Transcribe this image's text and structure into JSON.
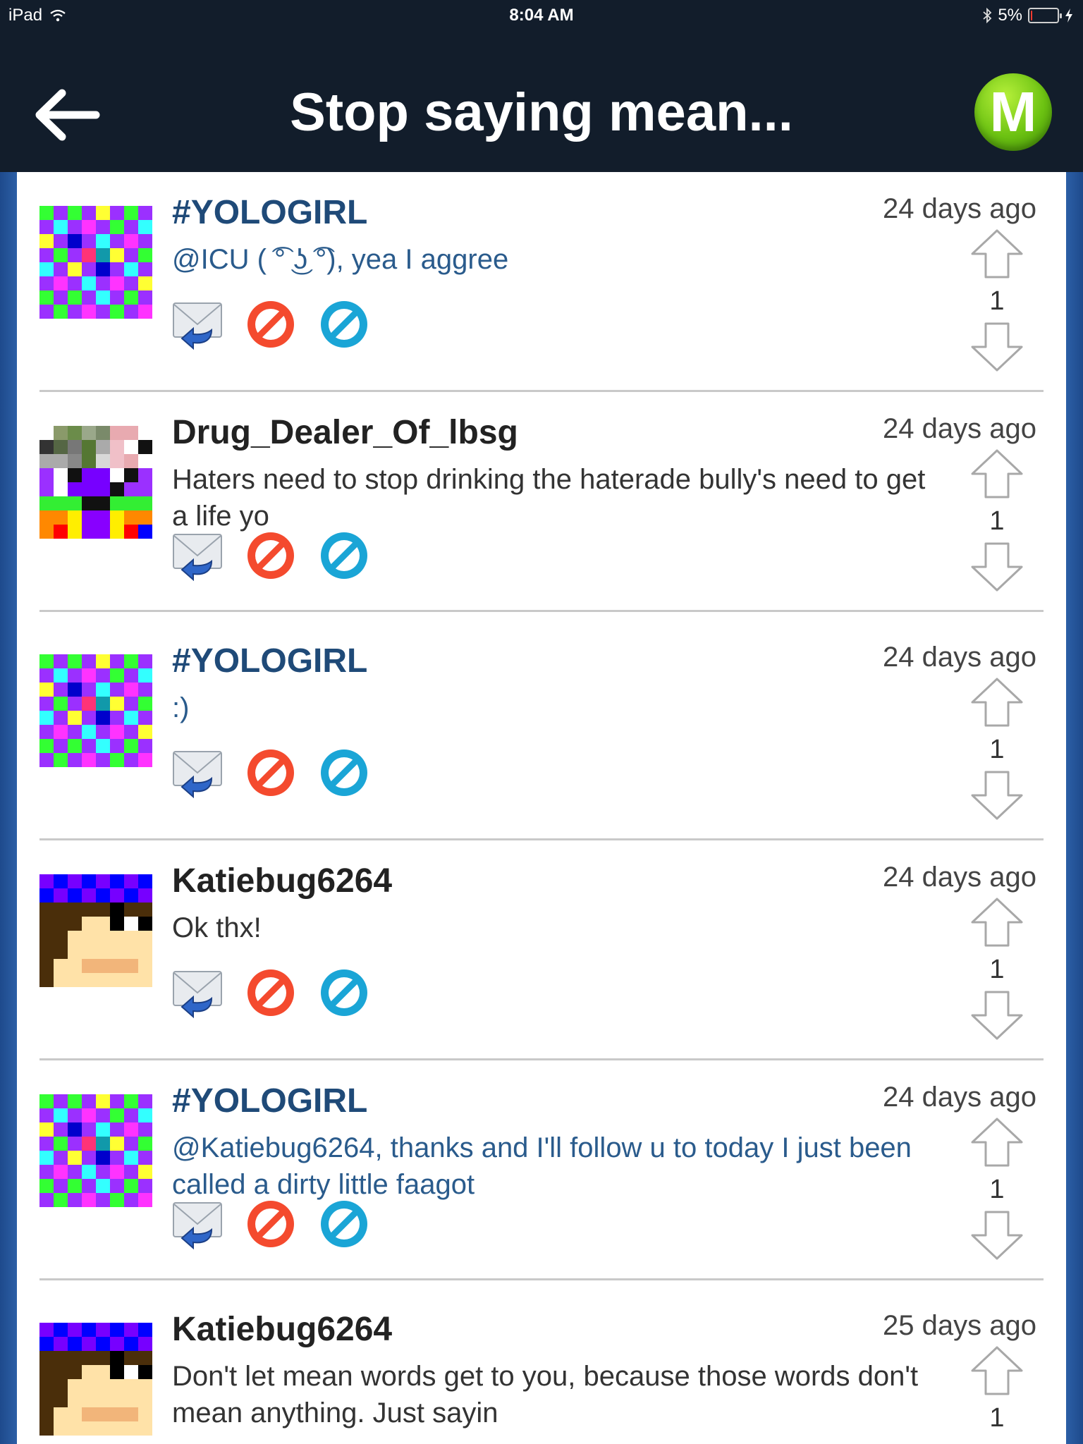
{
  "status_bar": {
    "device": "iPad",
    "time": "8:04 AM",
    "battery": "5%",
    "battery_level": 0.05
  },
  "nav": {
    "title": "Stop saying mean...",
    "logo_letter": "M"
  },
  "posts": [
    {
      "username": "#YOLOGIRL",
      "message": "@ICU ( ͡° ͜ʖ ͡°), yea I aggree",
      "time": "24 days ago",
      "votes": "1"
    },
    {
      "username": "Drug_Dealer_Of_lbsg",
      "message": "Haters need to stop drinking the haterade bully's need to get a life yo",
      "time": "24 days ago",
      "votes": "1"
    },
    {
      "username": "#YOLOGIRL",
      "message": ":)",
      "time": "24 days ago",
      "votes": "1"
    },
    {
      "username": "Katiebug6264",
      "message": "Ok thx!",
      "time": "24 days ago",
      "votes": "1"
    },
    {
      "username": "#YOLOGIRL",
      "message": "@Katiebug6264, thanks and I'll follow u to today I just been called a dirty little faagot",
      "time": "24 days ago",
      "votes": "1"
    },
    {
      "username": "Katiebug6264",
      "message": "Don't let mean words get to you, because those words don't mean anything. Just sayin",
      "time": "25 days ago",
      "votes": "1"
    }
  ]
}
